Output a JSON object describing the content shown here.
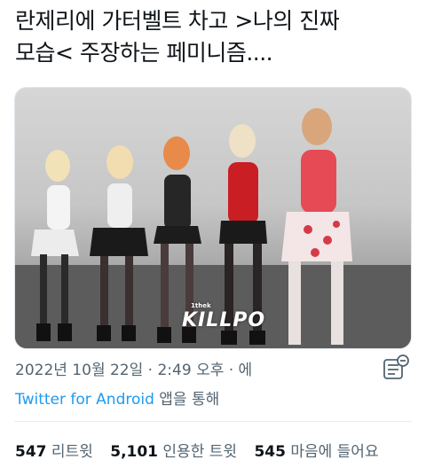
{
  "tweet": {
    "text_lines": [
      "란제리에 가터벨트 차고 >나의 진짜",
      "모습< 주장하는 페미니즘...."
    ]
  },
  "media": {
    "watermark": "KILLPO",
    "watermark_small": "1thek"
  },
  "meta": {
    "date": "2022년 10월 22일",
    "separator": "·",
    "time": "2:49 오후",
    "trailing": "· 에"
  },
  "source": {
    "app_name": "Twitter for Android",
    "suffix": " 앱을 통해"
  },
  "stats": {
    "retweets_count": "547",
    "retweets_label": "리트윗",
    "quotes_count": "5,101",
    "quotes_label": "인용한 트윗",
    "likes_count": "545",
    "likes_label": "마음에 들어요"
  },
  "colors": {
    "link": "#1d9bf0",
    "secondary_text": "#536471",
    "primary_text": "#0f1419"
  },
  "icons": {
    "analytics": "tweet-analytics-icon"
  }
}
